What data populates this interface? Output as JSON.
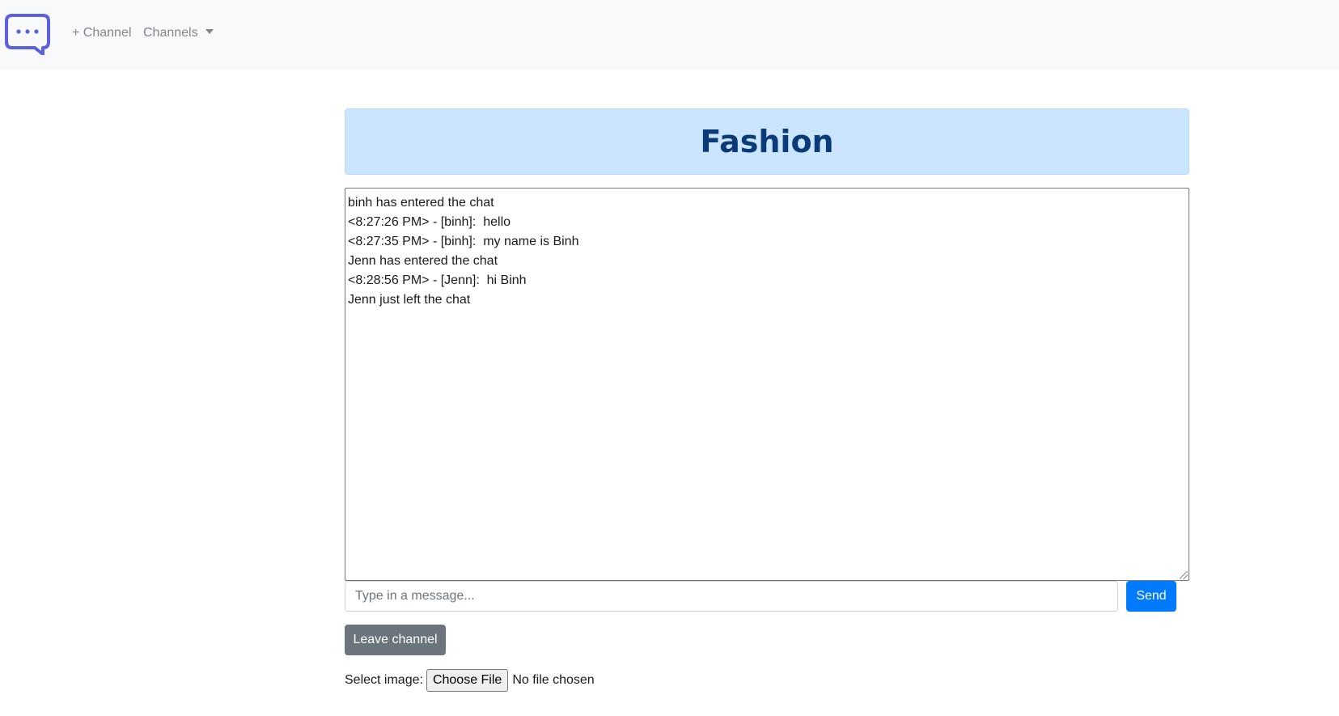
{
  "navbar": {
    "logo_icon": "chat-bubble-dots-icon",
    "add_channel_label": "+ Channel",
    "channels_dropdown_label": "Channels",
    "caret_icon": "caret-down-icon"
  },
  "channel": {
    "title": "Fashion"
  },
  "chat": {
    "lines": [
      "binh has entered the chat",
      "<8:27:26 PM> - [binh]:  hello",
      "<8:27:35 PM> - [binh]:  my name is Binh",
      "Jenn has entered the chat",
      "<8:28:56 PM> - [Jenn]:  hi Binh",
      "Jenn just left the chat"
    ]
  },
  "composer": {
    "placeholder": "Type in a message...",
    "value": "",
    "send_label": "Send"
  },
  "actions": {
    "leave_label": "Leave channel"
  },
  "image_upload": {
    "label": "Select image:",
    "button_label": "Choose File",
    "status": "No file chosen"
  },
  "colors": {
    "navbar_bg": "#f8f9fa",
    "logo": "#5b5fe0",
    "title_bg": "#cce5ff",
    "title_text": "#0a3a78",
    "primary": "#007bff",
    "secondary": "#6c757d"
  }
}
